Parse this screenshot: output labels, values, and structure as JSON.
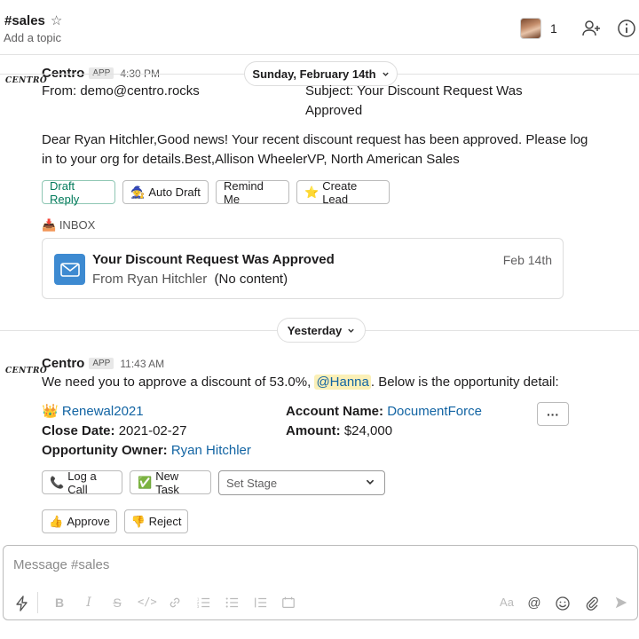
{
  "header": {
    "channel": "#sales",
    "topic": "Add a topic",
    "member_count": "1"
  },
  "message1": {
    "sender": "Centro",
    "logo": "CENTRO",
    "app_badge": "APP",
    "time": "4:30 PM",
    "from_label": "From:",
    "from_value": "demo@centro.rocks",
    "subject_label": "Subject",
    "subject_value": ": Your Discount Request Was Approved",
    "body_line1": "Dear Ryan Hitchler,Good news! Your recent discount request has been approved. Please log",
    "body_line2": "in to your org for details.Best,Allison WheelerVP, North American Sales",
    "buttons": {
      "draft_reply": "Draft Reply",
      "auto_draft": "Auto Draft",
      "remind_me": "Remind Me",
      "create_lead": "Create Lead"
    },
    "inbox_label": "INBOX",
    "card": {
      "title": "Your Discount Request Was Approved",
      "from": "From Ryan Hitchler",
      "content": "(No content)",
      "date": "Feb 14th"
    }
  },
  "dividers": {
    "first": "Sunday, February 14th",
    "second": "Yesterday"
  },
  "message2": {
    "sender": "Centro",
    "logo": "CENTRO",
    "app_badge": "APP",
    "time": "11:43 AM",
    "text_before": "We need you to approve a discount of 53.0%,",
    "mention": "@Hanna",
    "text_after": ". Below is the opportunity detail:",
    "opportunity": {
      "name": "Renewal2021",
      "account_label": "Account Name:",
      "account_value": "DocumentForce",
      "close_label": "Close Date:",
      "close_value": "2021-02-27",
      "amount_label": "Amount:",
      "amount_value": "$24,000",
      "owner_label": "Opportunity Owner:",
      "owner_value": "Ryan Hitchler"
    },
    "more": "···",
    "buttons": {
      "log_call": "Log a Call",
      "new_task": "New Task",
      "set_stage": "Set Stage",
      "approve": "Approve",
      "reject": "Reject"
    }
  },
  "composer": {
    "placeholder": "Message #sales",
    "format_aa": "Aa"
  },
  "colors": {
    "link": "#1264a3",
    "primary_button": "#007a5a",
    "mention_bg": "#fbf0b7",
    "mail_icon": "#3d8ad1"
  }
}
